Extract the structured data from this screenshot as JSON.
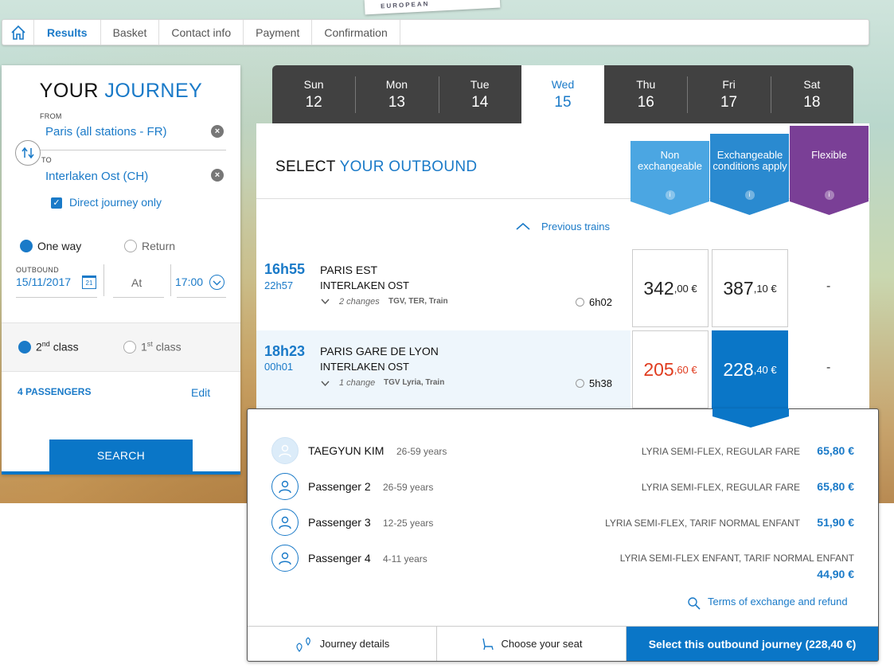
{
  "brand": {
    "logo_text": "EUROPEAN"
  },
  "nav": {
    "tabs": [
      {
        "label": "Results"
      },
      {
        "label": "Basket"
      },
      {
        "label": "Contact info"
      },
      {
        "label": "Payment"
      },
      {
        "label": "Confirmation"
      }
    ]
  },
  "journey": {
    "title_a": "YOUR",
    "title_b": "JOURNEY",
    "from_label": "FROM",
    "from_value": "Paris (all stations - FR)",
    "to_label": "TO",
    "to_value": "Interlaken Ost (CH)",
    "direct_only": "Direct journey only",
    "one_way": "One way",
    "return": "Return",
    "outbound_label": "OUTBOUND",
    "outbound_date": "15/11/2017",
    "calendar_day": "21",
    "at_label": "At",
    "time": "17:00",
    "class2_num": "2",
    "class2_sup": "nd",
    "class2_txt": "class",
    "class1_num": "1",
    "class1_sup": "st",
    "class1_txt": "class",
    "passengers": "4 PASSENGERS",
    "edit": "Edit",
    "search": "SEARCH"
  },
  "days": [
    {
      "name": "Sun",
      "num": "12"
    },
    {
      "name": "Mon",
      "num": "13"
    },
    {
      "name": "Tue",
      "num": "14"
    },
    {
      "name": "Wed",
      "num": "15"
    },
    {
      "name": "Thu",
      "num": "16"
    },
    {
      "name": "Fri",
      "num": "17"
    },
    {
      "name": "Sat",
      "num": "18"
    }
  ],
  "select": {
    "title_a": "SELECT",
    "title_b": "YOUR OUTBOUND",
    "fares": {
      "non_exchangeable": "Non exchangeable",
      "exchangeable": "Exchangeable conditions apply",
      "flexible": "Flexible",
      "info": "i"
    },
    "previous_trains": "Previous trains"
  },
  "trains": [
    {
      "dep": "16h55",
      "arr": "22h57",
      "from": "PARIS EST",
      "to": "INTERLAKEN OST",
      "changes": "2 changes",
      "types": "TGV, TER, Train",
      "duration": "6h02",
      "p1_big": "342",
      "p1_sm": ",00 €",
      "p2_big": "387",
      "p2_sm": ",10 €",
      "p3": "-"
    },
    {
      "dep": "18h23",
      "arr": "00h01",
      "from": "PARIS GARE DE LYON",
      "to": "INTERLAKEN OST",
      "changes": "1 change",
      "types": "TGV Lyria, Train",
      "duration": "5h38",
      "p1_big": "205",
      "p1_sm": ",60 €",
      "p2_big": "228",
      "p2_sm": ",40 €",
      "p3": "-"
    }
  ],
  "details": {
    "passengers": [
      {
        "name": "TAEGYUN KIM",
        "age": "26-59 years",
        "fare": "LYRIA SEMI-FLEX, REGULAR FARE",
        "price": "65,80 €"
      },
      {
        "name": "Passenger 2",
        "age": "26-59 years",
        "fare": "LYRIA SEMI-FLEX, REGULAR FARE",
        "price": "65,80 €"
      },
      {
        "name": "Passenger 3",
        "age": "12-25 years",
        "fare": "LYRIA SEMI-FLEX, TARIF NORMAL ENFANT",
        "price": "51,90 €"
      },
      {
        "name": "Passenger 4",
        "age": "4-11 years",
        "fare": "LYRIA SEMI-FLEX ENFANT, TARIF NORMAL ENFANT",
        "price": "44,90 €"
      }
    ],
    "terms": "Terms of exchange and refund",
    "journey_details": "Journey details",
    "choose_seat": "Choose your seat",
    "select_outbound": "Select this outbound journey (228,40 €)"
  },
  "colors": {
    "accent": "#1a7ac8",
    "primary_button": "#0a76c7",
    "non_exchangeable": "#4ba6e2",
    "exchangeable": "#2a8ad0",
    "flexible": "#7a3f96",
    "promo_price": "#e03c1f"
  },
  "icons": {
    "home": "home-icon",
    "swap": "swap-icon",
    "clear": "clear-icon",
    "calendar": "calendar-icon",
    "clock": "clock-icon",
    "chevron_up": "chevron-up-icon",
    "chevron_down": "chevron-down-icon",
    "user": "user-icon",
    "search": "magnifier-icon",
    "map_pin": "map-pin-icon",
    "seat": "seat-icon"
  }
}
